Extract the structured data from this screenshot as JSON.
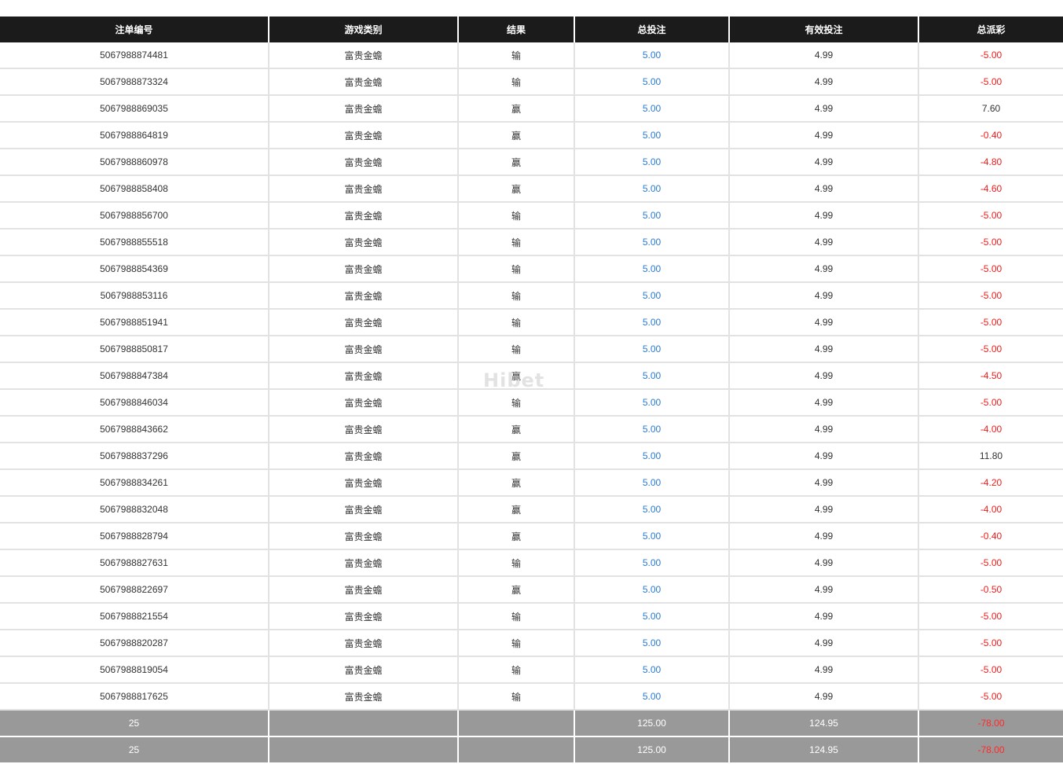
{
  "table": {
    "headers": [
      "注单编号",
      "游戏类别",
      "结果",
      "总投注",
      "有效投注",
      "总派彩"
    ],
    "rows": [
      {
        "id": "5067988874481",
        "game": "富贵金蟾",
        "result": "输",
        "stake": "5.00",
        "valid": "4.99",
        "payout": "-5.00"
      },
      {
        "id": "5067988873324",
        "game": "富贵金蟾",
        "result": "输",
        "stake": "5.00",
        "valid": "4.99",
        "payout": "-5.00"
      },
      {
        "id": "5067988869035",
        "game": "富贵金蟾",
        "result": "赢",
        "stake": "5.00",
        "valid": "4.99",
        "payout": "7.60"
      },
      {
        "id": "5067988864819",
        "game": "富贵金蟾",
        "result": "赢",
        "stake": "5.00",
        "valid": "4.99",
        "payout": "-0.40"
      },
      {
        "id": "5067988860978",
        "game": "富贵金蟾",
        "result": "赢",
        "stake": "5.00",
        "valid": "4.99",
        "payout": "-4.80"
      },
      {
        "id": "5067988858408",
        "game": "富贵金蟾",
        "result": "赢",
        "stake": "5.00",
        "valid": "4.99",
        "payout": "-4.60"
      },
      {
        "id": "5067988856700",
        "game": "富贵金蟾",
        "result": "输",
        "stake": "5.00",
        "valid": "4.99",
        "payout": "-5.00"
      },
      {
        "id": "5067988855518",
        "game": "富贵金蟾",
        "result": "输",
        "stake": "5.00",
        "valid": "4.99",
        "payout": "-5.00"
      },
      {
        "id": "5067988854369",
        "game": "富贵金蟾",
        "result": "输",
        "stake": "5.00",
        "valid": "4.99",
        "payout": "-5.00"
      },
      {
        "id": "5067988853116",
        "game": "富贵金蟾",
        "result": "输",
        "stake": "5.00",
        "valid": "4.99",
        "payout": "-5.00"
      },
      {
        "id": "5067988851941",
        "game": "富贵金蟾",
        "result": "输",
        "stake": "5.00",
        "valid": "4.99",
        "payout": "-5.00"
      },
      {
        "id": "5067988850817",
        "game": "富贵金蟾",
        "result": "输",
        "stake": "5.00",
        "valid": "4.99",
        "payout": "-5.00"
      },
      {
        "id": "5067988847384",
        "game": "富贵金蟾",
        "result": "赢",
        "stake": "5.00",
        "valid": "4.99",
        "payout": "-4.50"
      },
      {
        "id": "5067988846034",
        "game": "富贵金蟾",
        "result": "输",
        "stake": "5.00",
        "valid": "4.99",
        "payout": "-5.00"
      },
      {
        "id": "5067988843662",
        "game": "富贵金蟾",
        "result": "赢",
        "stake": "5.00",
        "valid": "4.99",
        "payout": "-4.00"
      },
      {
        "id": "5067988837296",
        "game": "富贵金蟾",
        "result": "赢",
        "stake": "5.00",
        "valid": "4.99",
        "payout": "11.80"
      },
      {
        "id": "5067988834261",
        "game": "富贵金蟾",
        "result": "赢",
        "stake": "5.00",
        "valid": "4.99",
        "payout": "-4.20"
      },
      {
        "id": "5067988832048",
        "game": "富贵金蟾",
        "result": "赢",
        "stake": "5.00",
        "valid": "4.99",
        "payout": "-4.00"
      },
      {
        "id": "5067988828794",
        "game": "富贵金蟾",
        "result": "赢",
        "stake": "5.00",
        "valid": "4.99",
        "payout": "-0.40"
      },
      {
        "id": "5067988827631",
        "game": "富贵金蟾",
        "result": "输",
        "stake": "5.00",
        "valid": "4.99",
        "payout": "-5.00"
      },
      {
        "id": "5067988822697",
        "game": "富贵金蟾",
        "result": "赢",
        "stake": "5.00",
        "valid": "4.99",
        "payout": "-0.50"
      },
      {
        "id": "5067988821554",
        "game": "富贵金蟾",
        "result": "输",
        "stake": "5.00",
        "valid": "4.99",
        "payout": "-5.00"
      },
      {
        "id": "5067988820287",
        "game": "富贵金蟾",
        "result": "输",
        "stake": "5.00",
        "valid": "4.99",
        "payout": "-5.00"
      },
      {
        "id": "5067988819054",
        "game": "富贵金蟾",
        "result": "输",
        "stake": "5.00",
        "valid": "4.99",
        "payout": "-5.00"
      },
      {
        "id": "5067988817625",
        "game": "富贵金蟾",
        "result": "输",
        "stake": "5.00",
        "valid": "4.99",
        "payout": "-5.00"
      }
    ],
    "summaries": [
      {
        "count": "25",
        "game": "",
        "result": "",
        "stake": "125.00",
        "valid": "124.95",
        "payout": "-78.00"
      },
      {
        "count": "25",
        "game": "",
        "result": "",
        "stake": "125.00",
        "valid": "124.95",
        "payout": "-78.00"
      }
    ]
  },
  "watermark": "Hibet",
  "colors": {
    "header_bg": "#1b1b1b",
    "stake_blue": "#2a7bd1",
    "negative_red": "#ee1c1c",
    "summary_bg": "#999999"
  }
}
